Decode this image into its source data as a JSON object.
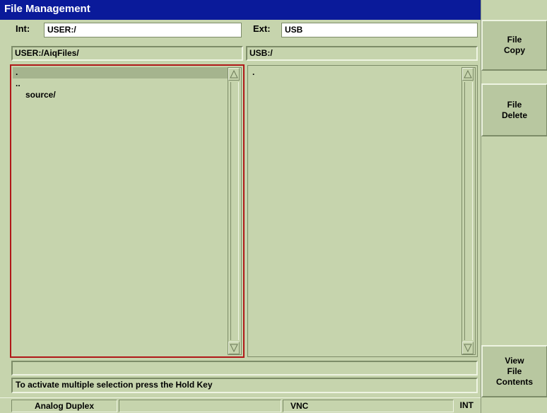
{
  "window": {
    "title": "File Management"
  },
  "internal": {
    "label": "Int:",
    "value": "USER:/",
    "path": "USER:/AiqFiles/"
  },
  "external": {
    "label": "Ext:",
    "value": "USB",
    "path": "USB:/"
  },
  "left_list": {
    "items": [
      ".",
      "..",
      "source/"
    ]
  },
  "right_list": {
    "items": [
      "."
    ]
  },
  "softkeys": {
    "file_copy": "File\nCopy",
    "file_delete": "File\nDelete",
    "view_file_contents": "View\nFile\nContents"
  },
  "status": {
    "line1": "",
    "line2": "To activate multiple selection press the Hold Key"
  },
  "bottom_bar": {
    "mode": "Analog Duplex",
    "middle": "",
    "remote": "VNC",
    "source": "INT"
  },
  "colors": {
    "title_bar": "#0a1a9a",
    "background": "#c6d4ad",
    "selection_border": "#b01818"
  }
}
